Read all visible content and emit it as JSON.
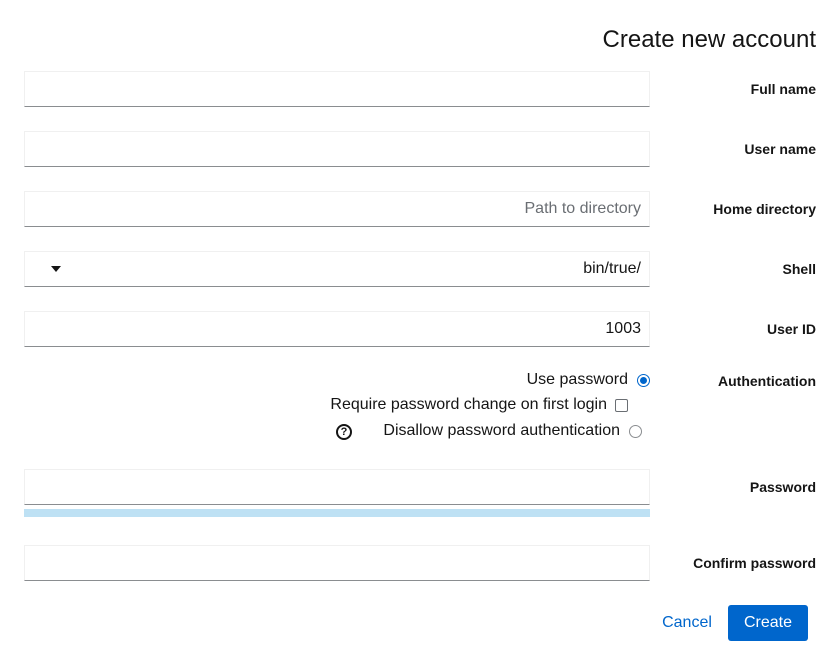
{
  "dialog": {
    "title": "Create new account",
    "full_name": {
      "label": "Full name",
      "value": ""
    },
    "user_name": {
      "label": "User name",
      "value": ""
    },
    "home_directory": {
      "label": "Home directory",
      "placeholder": "Path to directory",
      "value": ""
    },
    "shell": {
      "label": "Shell",
      "value": "bin/true/"
    },
    "user_id": {
      "label": "User ID",
      "value": "1003"
    },
    "authentication": {
      "label": "Authentication",
      "use_password": "Use password",
      "require_change": "Require password change on first login",
      "disallow": "Disallow password authentication"
    },
    "password": {
      "label": "Password",
      "value": "",
      "strength_fraction": 1.0
    },
    "confirm_password": {
      "label": "Confirm password",
      "value": ""
    },
    "buttons": {
      "cancel": "Cancel",
      "create": "Create"
    }
  },
  "colors": {
    "accent": "#0066cc",
    "strength_bar": "#bee1f4"
  },
  "icons": {
    "help": "question-circle-icon",
    "caret": "caret-down-icon"
  }
}
